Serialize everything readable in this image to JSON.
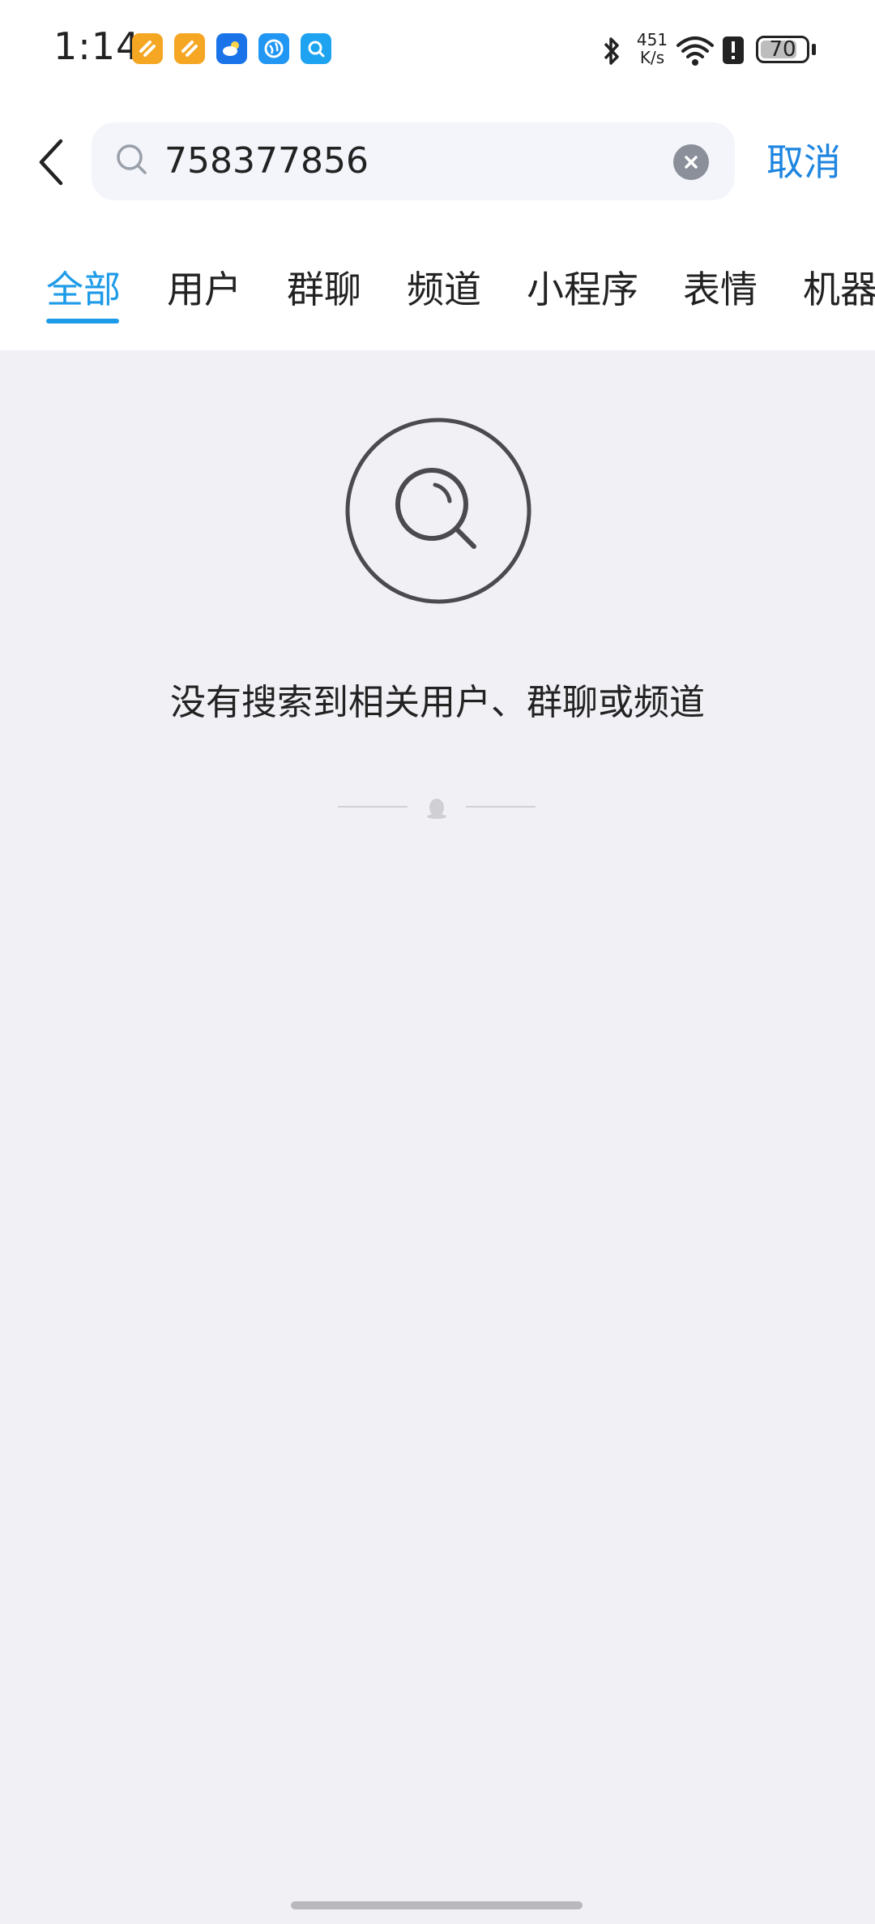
{
  "status_bar": {
    "time": "1:14",
    "network_speed_value": "451",
    "network_speed_unit": "K/s",
    "battery_level": "70"
  },
  "header": {
    "search_value": "758377856",
    "cancel_label": "取消"
  },
  "tabs": [
    {
      "label": "全部",
      "active": true
    },
    {
      "label": "用户",
      "active": false
    },
    {
      "label": "群聊",
      "active": false
    },
    {
      "label": "频道",
      "active": false
    },
    {
      "label": "小程序",
      "active": false
    },
    {
      "label": "表情",
      "active": false
    },
    {
      "label": "机器",
      "active": false
    }
  ],
  "empty_state": {
    "message": "没有搜索到相关用户、群聊或频道"
  },
  "colors": {
    "accent": "#1e9be8",
    "cancel": "#1e86e0",
    "background": "#f0f0f5"
  }
}
